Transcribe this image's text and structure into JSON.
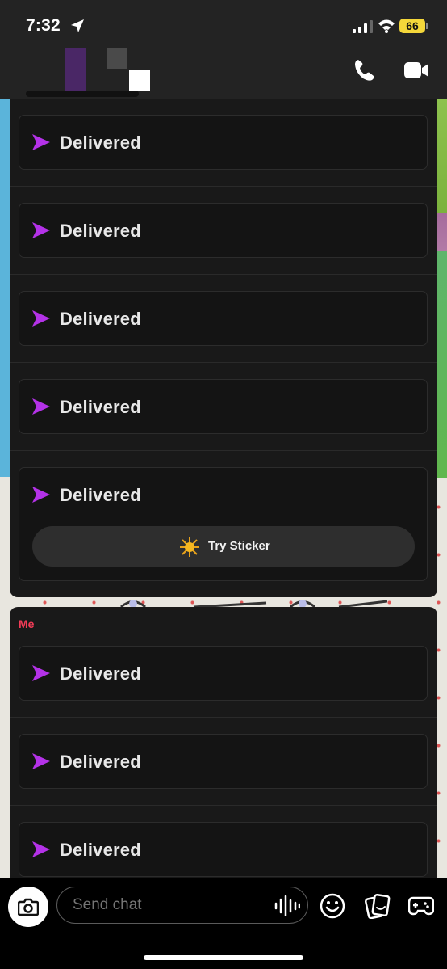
{
  "status_bar": {
    "time": "7:32",
    "battery": "66",
    "battery_color": "#f4d73a",
    "icons": [
      "location-arrow-icon",
      "cellular-signal-icon",
      "wifi-icon",
      "battery-icon"
    ]
  },
  "header": {
    "icons": [
      "phone-call-icon",
      "video-call-icon"
    ]
  },
  "conversation": {
    "group1": {
      "messages": [
        {
          "status": "Delivered"
        },
        {
          "status": "Delivered"
        },
        {
          "status": "Delivered"
        },
        {
          "status": "Delivered"
        },
        {
          "status": "Delivered"
        }
      ],
      "sticker_button": "Try Sticker"
    },
    "group2": {
      "sender": "Me",
      "sender_color": "#f23c57",
      "messages": [
        {
          "status": "Delivered"
        },
        {
          "status": "Delivered"
        },
        {
          "status": "Delivered"
        }
      ]
    },
    "delivered_arrow_color": "#b432e8"
  },
  "composer": {
    "placeholder": "Send chat",
    "icons": [
      "camera-icon",
      "voice-note-icon",
      "emoji-icon",
      "sticker-cards-icon",
      "game-controller-icon"
    ]
  }
}
